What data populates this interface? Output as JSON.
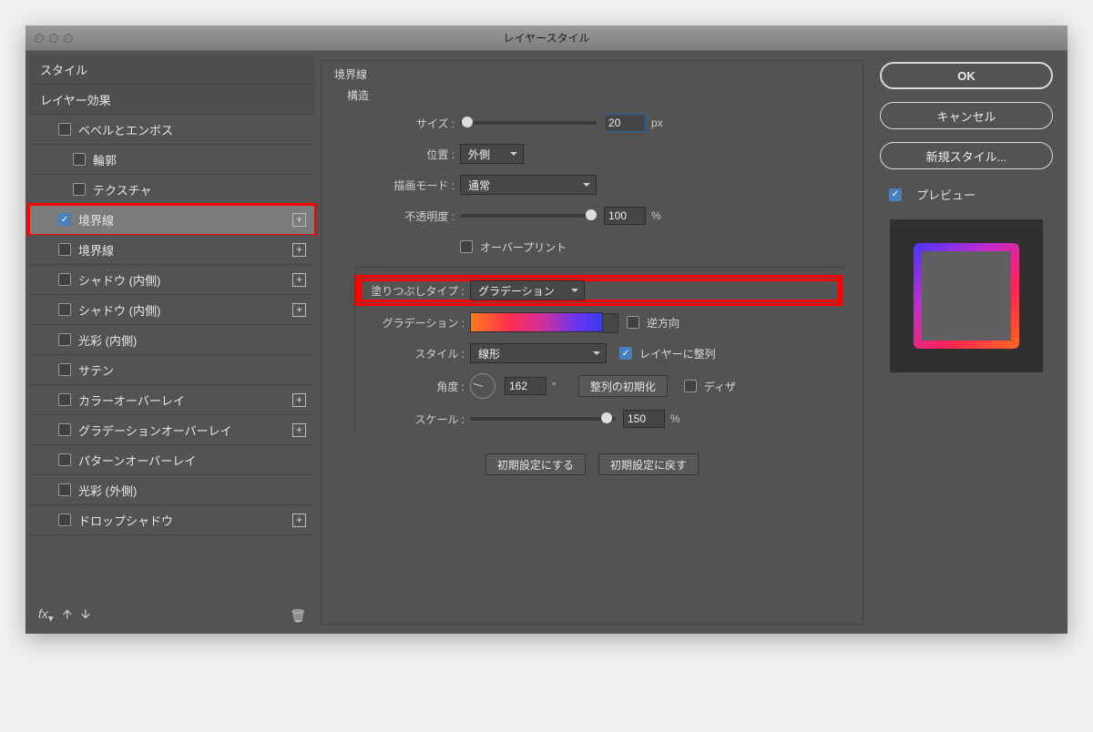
{
  "title": "レイヤースタイル",
  "sidebar": {
    "styles_header": "スタイル",
    "effects_header": "レイヤー効果",
    "items": [
      {
        "label": "ベベルとエンボス",
        "indent": 1,
        "plus": false,
        "checked": false
      },
      {
        "label": "輪郭",
        "indent": 2,
        "plus": false,
        "checked": false
      },
      {
        "label": "テクスチャ",
        "indent": 2,
        "plus": false,
        "checked": false
      },
      {
        "label": "境界線",
        "indent": 1,
        "plus": true,
        "checked": true,
        "selected": true,
        "highlight": true
      },
      {
        "label": "境界線",
        "indent": 1,
        "plus": true,
        "checked": false
      },
      {
        "label": "シャドウ (内側)",
        "indent": 1,
        "plus": true,
        "checked": false
      },
      {
        "label": "シャドウ (内側)",
        "indent": 1,
        "plus": true,
        "checked": false
      },
      {
        "label": "光彩 (内側)",
        "indent": 1,
        "plus": false,
        "checked": false
      },
      {
        "label": "サテン",
        "indent": 1,
        "plus": false,
        "checked": false
      },
      {
        "label": "カラーオーバーレイ",
        "indent": 1,
        "plus": true,
        "checked": false
      },
      {
        "label": "グラデーションオーバーレイ",
        "indent": 1,
        "plus": true,
        "checked": false
      },
      {
        "label": "パターンオーバーレイ",
        "indent": 1,
        "plus": false,
        "checked": false
      },
      {
        "label": "光彩 (外側)",
        "indent": 1,
        "plus": false,
        "checked": false
      },
      {
        "label": "ドロップシャドウ",
        "indent": 1,
        "plus": true,
        "checked": false
      }
    ],
    "footer_fx": "fx"
  },
  "main": {
    "group_title": "境界線",
    "structure_title": "構造",
    "size_label": "サイズ :",
    "size_value": "20",
    "px": "px",
    "position_label": "位置 :",
    "position_value": "外側",
    "blend_label": "描画モード :",
    "blend_value": "通常",
    "opacity_label": "不透明度 :",
    "opacity_value": "100",
    "percent": "%",
    "overprint_label": "オーバープリント",
    "filltype_label": "塗りつぶしタイプ :",
    "filltype_value": "グラデーション",
    "gradient_label": "グラデーション :",
    "reverse_label": "逆方向",
    "style_label": "スタイル :",
    "style_value": "線形",
    "align_layer_label": "レイヤーに整列",
    "angle_label": "角度 :",
    "angle_value": "162",
    "degree": "°",
    "reset_align": "整列の初期化",
    "dither_label": "ディザ",
    "scale_label": "スケール :",
    "scale_value": "150",
    "make_default": "初期設定にする",
    "reset_default": "初期設定に戻す"
  },
  "right": {
    "ok": "OK",
    "cancel": "キャンセル",
    "new_style": "新規スタイル...",
    "preview": "プレビュー"
  }
}
